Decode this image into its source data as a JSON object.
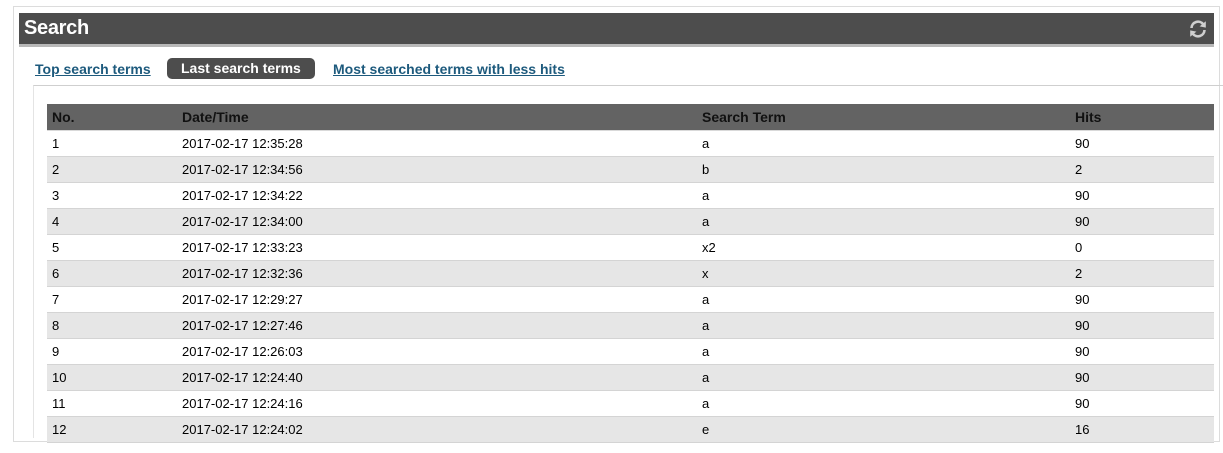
{
  "widget": {
    "title": "Search",
    "refresh_icon": "refresh-icon"
  },
  "tabs": [
    {
      "label": "Top search terms",
      "active": false
    },
    {
      "label": "Last search terms",
      "active": true
    },
    {
      "label": "Most searched terms with less hits",
      "active": false
    }
  ],
  "table": {
    "columns": [
      "No.",
      "Date/Time",
      "Search Term",
      "Hits"
    ],
    "rows": [
      [
        "1",
        "2017-02-17 12:35:28",
        "a",
        "90"
      ],
      [
        "2",
        "2017-02-17 12:34:56",
        "b",
        "2"
      ],
      [
        "3",
        "2017-02-17 12:34:22",
        "a",
        "90"
      ],
      [
        "4",
        "2017-02-17 12:34:00",
        "a",
        "90"
      ],
      [
        "5",
        "2017-02-17 12:33:23",
        "x2",
        "0"
      ],
      [
        "6",
        "2017-02-17 12:32:36",
        "x",
        "2"
      ],
      [
        "7",
        "2017-02-17 12:29:27",
        "a",
        "90"
      ],
      [
        "8",
        "2017-02-17 12:27:46",
        "a",
        "90"
      ],
      [
        "9",
        "2017-02-17 12:26:03",
        "a",
        "90"
      ],
      [
        "10",
        "2017-02-17 12:24:40",
        "a",
        "90"
      ],
      [
        "11",
        "2017-02-17 12:24:16",
        "a",
        "90"
      ],
      [
        "12",
        "2017-02-17 12:24:02",
        "e",
        "16"
      ]
    ]
  },
  "colors": {
    "header_bg": "#4d4d4d",
    "link": "#1d5a7d",
    "table_header_bg": "#636363",
    "row_alt": "#e6e6e6"
  }
}
